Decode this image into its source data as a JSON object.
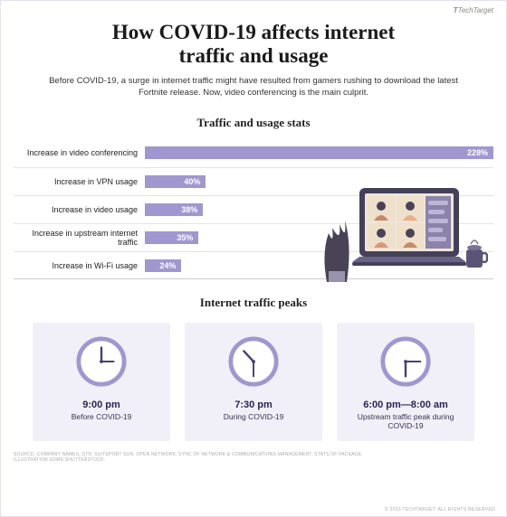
{
  "brand": "TechTarget",
  "title_line1": "How COVID-19 affects internet",
  "title_line2": "traffic and usage",
  "subtitle": "Before COVID-19, a surge in internet traffic might have resulted from gamers rushing to download the latest Fortnite release. Now, video conferencing is the main culprit.",
  "section_traffic": "Traffic and usage stats",
  "section_peaks": "Internet traffic peaks",
  "chart_data": {
    "type": "bar",
    "title": "Traffic and usage stats",
    "xlabel": "",
    "ylabel": "",
    "categories": [
      "Increase in video conferencing",
      "Increase in VPN usage",
      "Increase in video usage",
      "Increase in upstream internet traffic",
      "Increase in Wi-Fi usage"
    ],
    "values": [
      228,
      40,
      38,
      35,
      24
    ],
    "value_labels": [
      "228%",
      "40%",
      "38%",
      "35%",
      "24%"
    ],
    "xlim": [
      0,
      230
    ],
    "bar_color": "#a197cf"
  },
  "peaks": [
    {
      "time": "9:00 pm",
      "label": "Before COVID-19",
      "hour": 9,
      "minute": 0
    },
    {
      "time": "7:30 pm",
      "label": "During COVID-19",
      "hour": 7,
      "minute": 30
    },
    {
      "time": "6:00 pm—8:00 am",
      "label": "Upstream traffic peak during COVID-19",
      "hour": 6,
      "minute": 0
    }
  ],
  "sources_line1": "SOURCE: COMPANY NAMES, STR, SUITEPORT SUN, OPEN NETWORK, SYNC OF NETWORK & COMMUNICATIONS MANAGEMENT, STATS OF PACKAGE.",
  "sources_line2": "ILLUSTRATION SOME:SHUTTERSTOCK.",
  "footer": "© 2020 TECHTARGET. ALL RIGHTS RESERVED"
}
